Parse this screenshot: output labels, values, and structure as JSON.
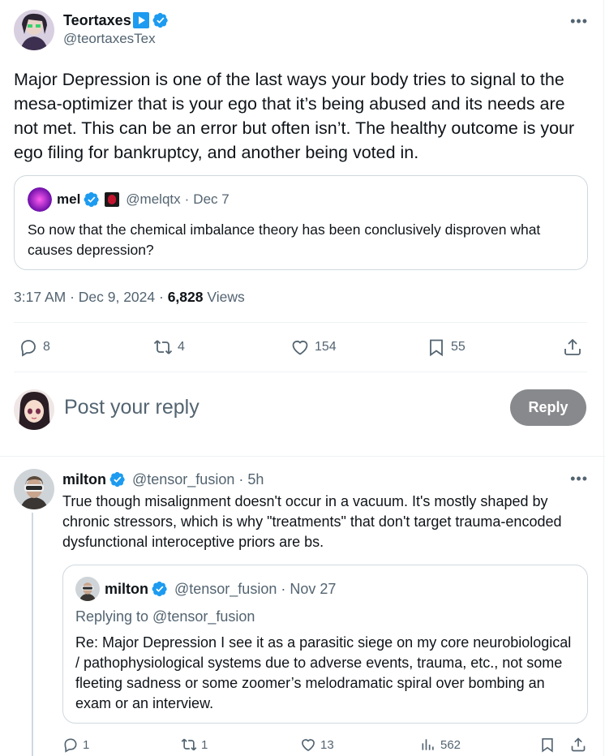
{
  "main_tweet": {
    "author_name": "Teortaxes",
    "author_handle": "@teortaxesTex",
    "more_label": "•••",
    "text": "Major Depression is one of the last ways your body tries to signal to the mesa-optimizer that is your ego that it’s being abused and its needs are not met. This can be an error but often isn’t. The healthy outcome is your ego filing for bankruptcy, and another being voted in.",
    "quote": {
      "author_name": "mel",
      "author_handle": "@melqtx",
      "separator": "·",
      "date": "Dec 7",
      "text": "So now that the chemical imbalance theory has been conclusively disproven what causes depression?"
    },
    "timestamp": "3:17 AM · Dec 9, 2024 · ",
    "views_count": "6,828",
    "views_label": " Views",
    "stats": {
      "replies": "8",
      "reposts": "4",
      "likes": "154",
      "bookmarks": "55"
    }
  },
  "reply_box": {
    "placeholder": "Post your reply",
    "button_label": "Reply"
  },
  "reply_tweet": {
    "author_name": "milton",
    "author_handle": "@tensor_fusion",
    "separator": "·",
    "time": "5h",
    "more_label": "•••",
    "text": "True though misalignment doesn't occur in a vacuum. It's mostly shaped by chronic stressors, which is why \"treatments\" that don't target trauma-encoded dysfunctional interoceptive priors are bs.",
    "quote": {
      "author_name": "milton",
      "author_handle": "@tensor_fusion",
      "separator": "·",
      "date": "Nov 27",
      "replying_to": "Replying to @tensor_fusion",
      "text": "Re: Major Depression I see it as a parasitic siege on my core neurobiological / pathophysiological systems due to adverse events, trauma, etc., not some fleeting sadness or some zoomer’s melodramatic spiral over bombing an exam or an interview."
    },
    "stats": {
      "replies": "1",
      "reposts": "1",
      "likes": "13",
      "views": "562"
    }
  },
  "colors": {
    "text": "#0f1419",
    "muted": "#536471",
    "verified": "#1d9bf0",
    "border": "#cfd9de",
    "reply_button": "#87898c"
  },
  "icons": [
    "verified-badge-icon",
    "play-badge-icon",
    "rose-emoji-icon",
    "more-icon",
    "reply-icon",
    "repost-icon",
    "like-icon",
    "bookmark-icon",
    "share-icon",
    "views-icon"
  ]
}
